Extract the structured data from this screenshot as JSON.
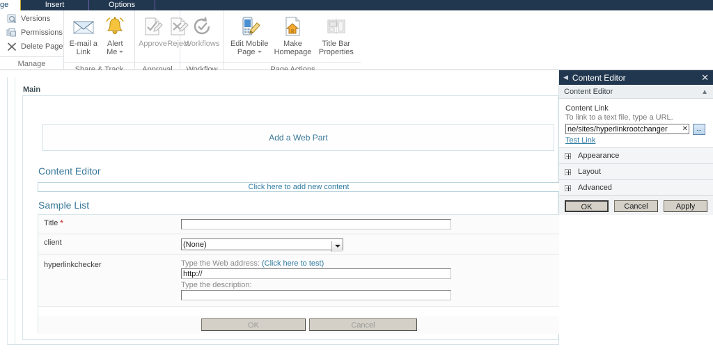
{
  "ribbon": {
    "tabs": [
      {
        "label": "ge",
        "active": true,
        "cut": true
      },
      {
        "label": "Insert",
        "active": false
      },
      {
        "label": "Options",
        "active": false
      }
    ],
    "groups": [
      {
        "label": "Manage",
        "kind": "small",
        "items": [
          {
            "label": "Versions",
            "icon": "versions-icon"
          },
          {
            "label": "Permissions",
            "icon": "permissions-icon"
          },
          {
            "label": "Delete Page",
            "icon": "delete-page-icon"
          }
        ]
      },
      {
        "label": "Share & Track",
        "kind": "large",
        "items": [
          {
            "label": "E-mail a\nLink",
            "icon": "email-link-icon",
            "dropdown": false,
            "disabled": false
          },
          {
            "label": "Alert\nMe",
            "icon": "alert-me-icon",
            "dropdown": true,
            "disabled": false
          }
        ]
      },
      {
        "label": "Approval",
        "kind": "large",
        "items": [
          {
            "label": "Approve",
            "icon": "approve-icon",
            "dropdown": false,
            "disabled": true
          },
          {
            "label": "Reject",
            "icon": "reject-icon",
            "dropdown": false,
            "disabled": true
          }
        ]
      },
      {
        "label": "Workflow",
        "kind": "large",
        "items": [
          {
            "label": "Workflows",
            "icon": "workflows-icon",
            "dropdown": false,
            "disabled": true
          }
        ]
      },
      {
        "label": "Page Actions",
        "kind": "large",
        "items": [
          {
            "label": "Edit Mobile\nPage",
            "icon": "edit-mobile-page-icon",
            "dropdown": true,
            "disabled": false
          },
          {
            "label": "Make\nHomepage",
            "icon": "make-homepage-icon",
            "dropdown": false,
            "disabled": false
          },
          {
            "label": "Title Bar\nProperties",
            "icon": "title-bar-properties-icon",
            "dropdown": false,
            "disabled": false
          }
        ]
      }
    ]
  },
  "page": {
    "zone_label": "Main",
    "add_web_part": "Add a Web Part",
    "content_editor_title": "Content Editor",
    "add_content_prompt": "Click here to add new content",
    "sample_list_title": "Sample List",
    "form": {
      "rows": [
        {
          "label": "Title",
          "required": true,
          "type": "text",
          "value": ""
        },
        {
          "label": "client",
          "required": false,
          "type": "select",
          "value": "(None)",
          "options": [
            "(None)"
          ]
        },
        {
          "label": "hyperlinkchecker",
          "required": false,
          "type": "hyperlink",
          "url_hint": "Type the Web address:",
          "url_test_label": "(Click here to test)",
          "url_value": "http://",
          "desc_hint": "Type the description:",
          "desc_value": ""
        }
      ],
      "ok_label": "OK",
      "cancel_label": "Cancel"
    }
  },
  "toolpane": {
    "header_title": "Content Editor",
    "close_icon": "close-icon",
    "back_icon": "back-arrow-icon",
    "section_title": "Content Editor",
    "collapse_icon": "chevron-up-icon",
    "content_link_label": "Content Link",
    "content_link_hint": "To link to a text file, type a URL.",
    "content_link_value": "ne/sites/hyperlinkrootchanger",
    "clear_icon": "clear-icon",
    "browse_label": "...",
    "test_link_label": "Test Link",
    "sections": [
      {
        "label": "Appearance"
      },
      {
        "label": "Layout"
      },
      {
        "label": "Advanced"
      }
    ],
    "buttons": {
      "ok": "OK",
      "cancel": "Cancel",
      "apply": "Apply"
    }
  },
  "colors": {
    "ribbon_tabbar": "#21374f",
    "accent_link": "#2f7ca3",
    "wp_title": "#3a7899",
    "required_star": "#d14444"
  }
}
